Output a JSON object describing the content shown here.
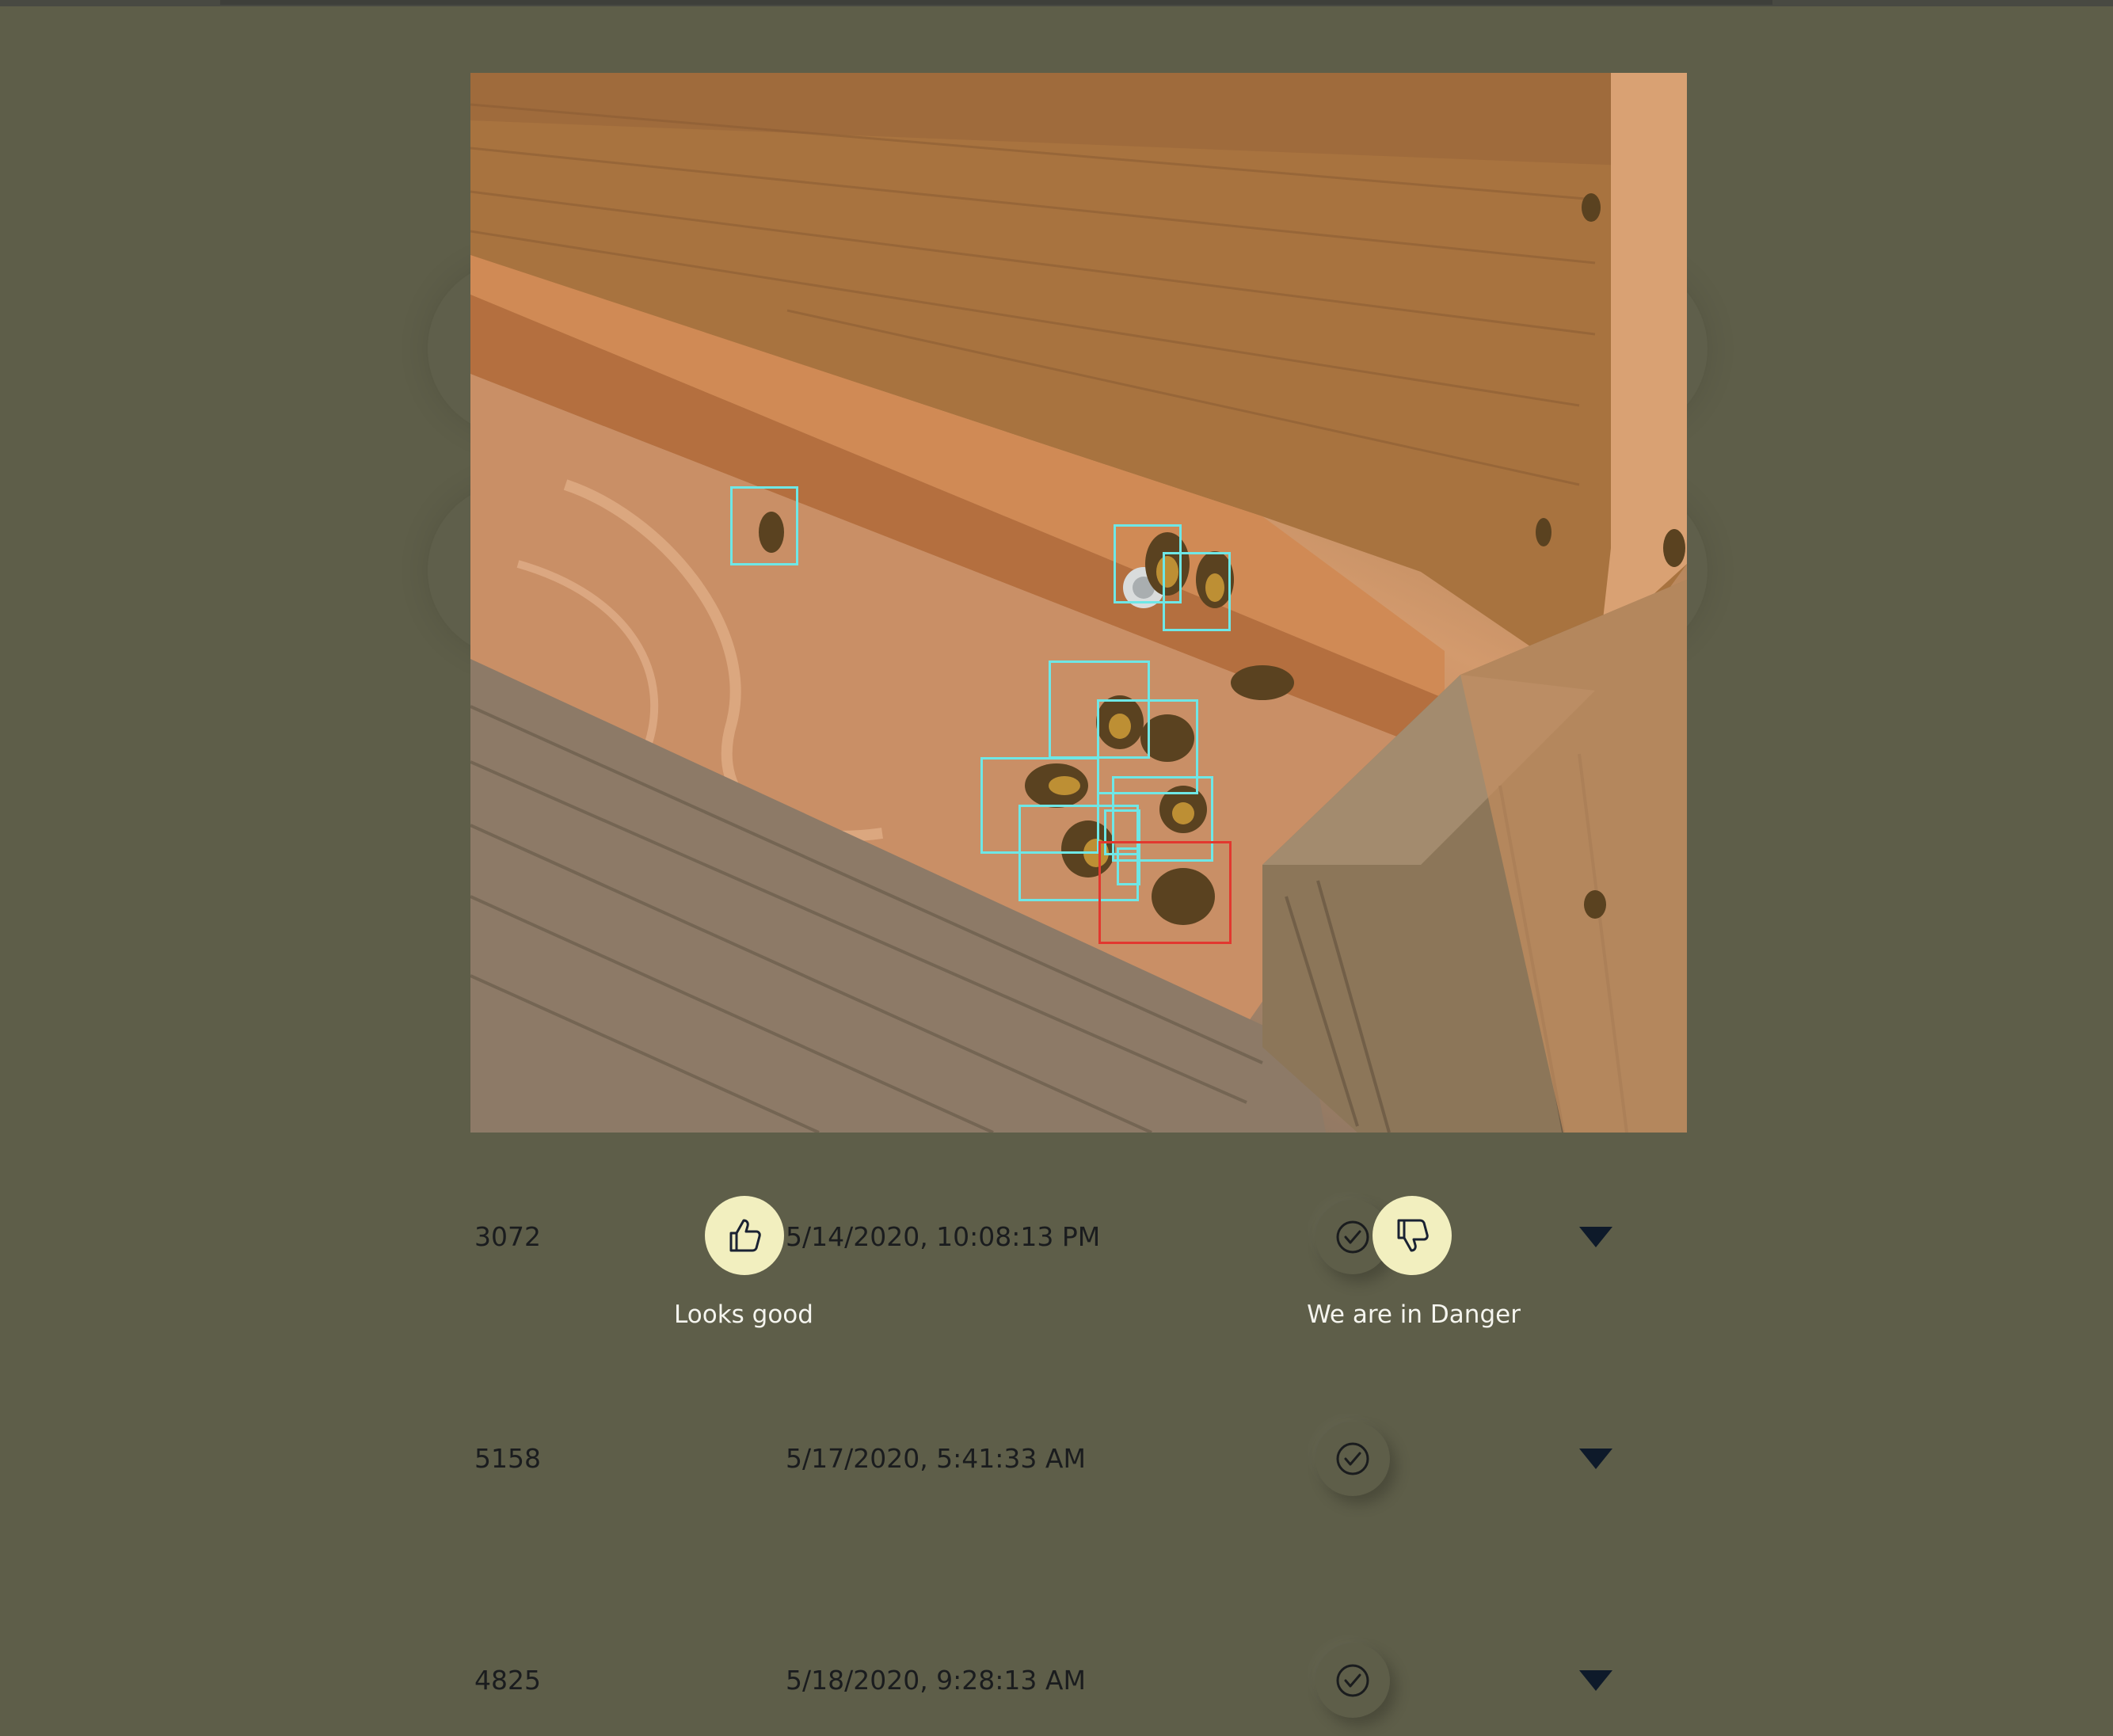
{
  "detections": {
    "normal_count": 10,
    "danger_count": 1,
    "normal_color": "#6ee7e6",
    "danger_color": "#e2382f"
  },
  "feedback": {
    "good_label": "Looks good",
    "good_icon": "thumbs-up-icon",
    "danger_label": "We are in Danger",
    "danger_icon": "thumbs-down-icon",
    "button_color": "#f2efbf"
  },
  "rows": [
    {
      "id": "3072",
      "timestamp": "5/14/2020, 10:08:13 PM",
      "status_icon": "check-circle-icon",
      "expand_icon": "caret-down-icon"
    },
    {
      "id": "5158",
      "timestamp": "5/17/2020, 5:41:33 AM",
      "status_icon": "check-circle-icon",
      "expand_icon": "caret-down-icon"
    },
    {
      "id": "4825",
      "timestamp": "5/18/2020, 9:28:13 AM",
      "status_icon": "check-circle-icon",
      "expand_icon": "caret-down-icon"
    }
  ],
  "colors": {
    "background": "#5e5e49",
    "text": "#1a1c1e"
  }
}
